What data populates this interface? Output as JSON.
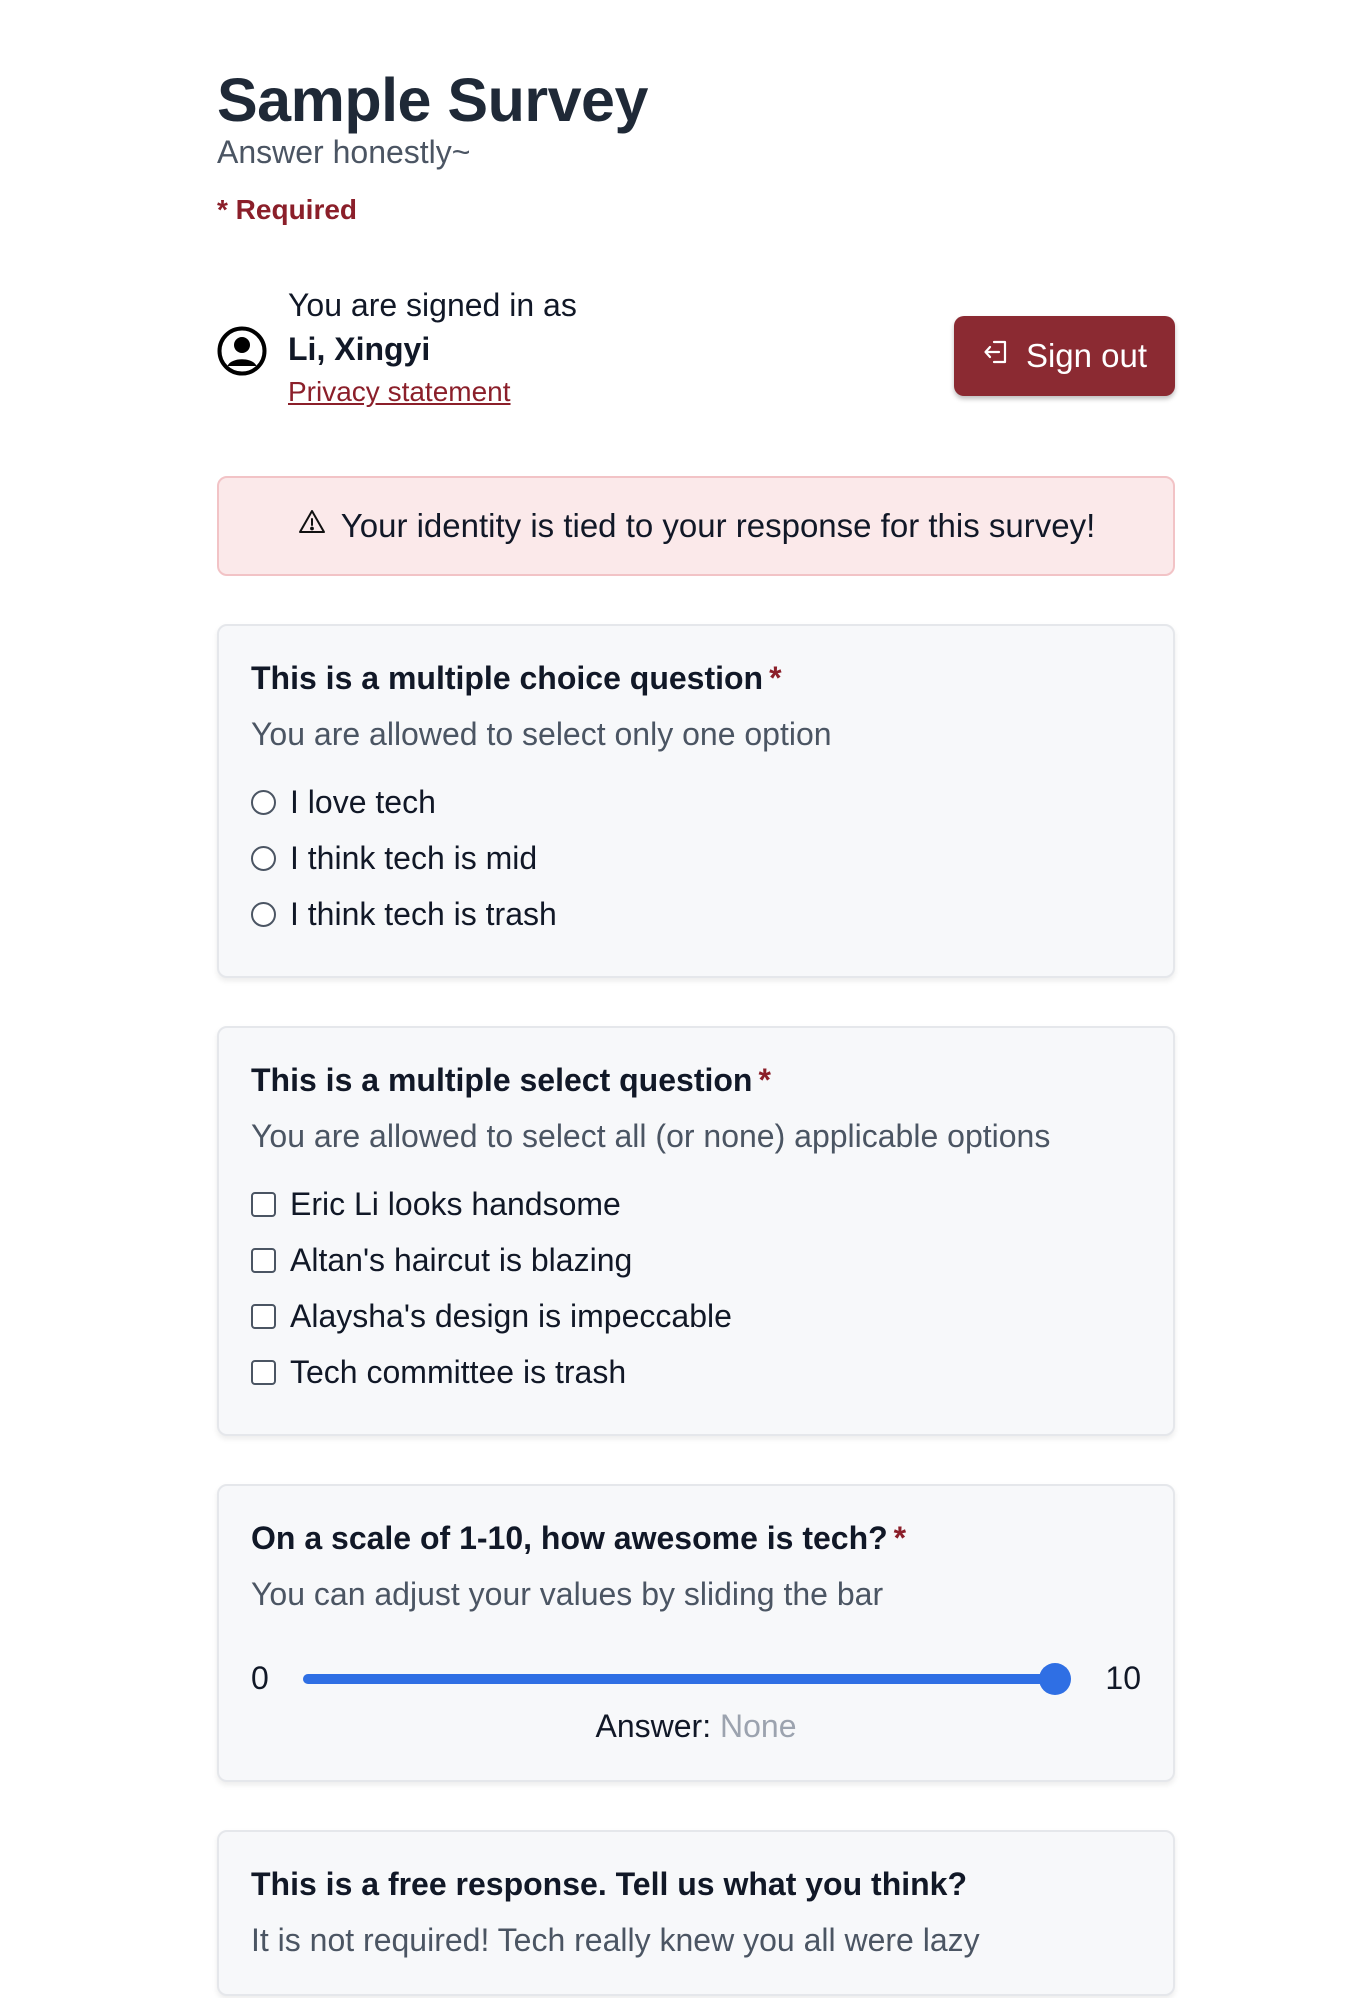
{
  "survey": {
    "title": "Sample Survey",
    "subtitle": "Answer honestly~",
    "required_note": "* Required"
  },
  "user": {
    "signed_in_label": "You are signed in as",
    "name": "Li, Xingyi",
    "privacy_link": "Privacy statement",
    "sign_out_label": "Sign out"
  },
  "alert": {
    "text": "Your identity is tied to your response for this survey!"
  },
  "questions": [
    {
      "title": "This is a multiple choice question",
      "required_mark": "*",
      "description": "You are allowed to select only one option",
      "type": "radio",
      "options": [
        "I love tech",
        "I think tech is mid",
        "I think tech is trash"
      ]
    },
    {
      "title": "This is a multiple select question",
      "required_mark": "*",
      "description": "You are allowed to select all (or none) applicable options",
      "type": "checkbox",
      "options": [
        "Eric Li looks handsome",
        "Altan's haircut is blazing",
        "Alaysha's design is impeccable",
        "Tech committee is trash"
      ]
    },
    {
      "title": "On a scale of 1-10, how awesome is tech?",
      "required_mark": "*",
      "description": "You can adjust your values by sliding the bar",
      "type": "slider",
      "min_label": "0",
      "max_label": "10",
      "min": 0,
      "max": 10,
      "value": 10,
      "answer_label": "Answer:",
      "answer_value": "None"
    },
    {
      "title": "This is a free response. Tell us what you think?",
      "description": "It is not required! Tech really knew you all were lazy",
      "type": "text"
    }
  ],
  "colors": {
    "accent": "#8b2a32",
    "required": "#8b1f2a",
    "slider": "#2f6fe4",
    "alert_bg": "#fbe9ea"
  },
  "icons": {
    "avatar": "user-circle-icon",
    "sign_out": "sign-out-icon",
    "alert": "warning-triangle-icon"
  }
}
